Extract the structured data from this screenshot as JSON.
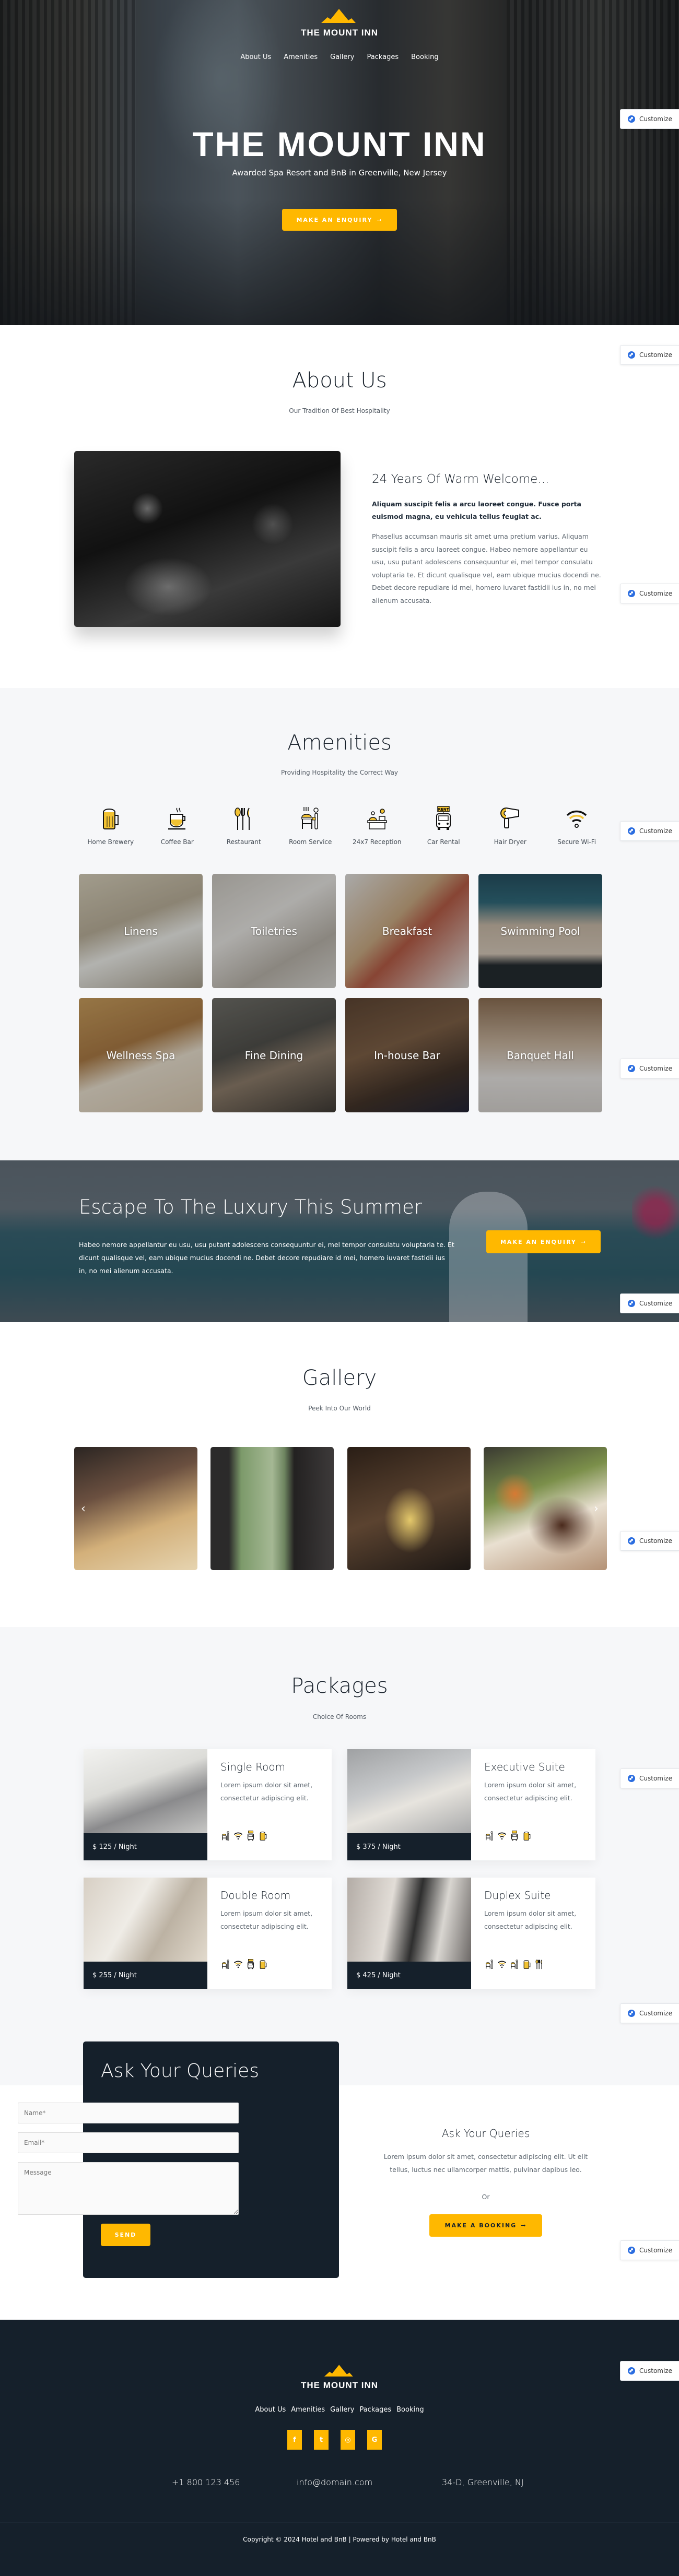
{
  "brand": {
    "name": "THE MOUNT INN",
    "accent": "#ffb800",
    "dark": "#15202b"
  },
  "nav": [
    "About Us",
    "Amenities",
    "Gallery",
    "Packages",
    "Booking"
  ],
  "hero": {
    "title": "THE MOUNT INN",
    "subtitle": "Awarded Spa Resort and BnB in Greenville, New Jersey",
    "cta": "MAKE AN ENQUIRY",
    "cta_icon": "arrow-right-icon"
  },
  "customize_label": "Customize",
  "about": {
    "title": "About Us",
    "subtitle": "Our Tradition Of Best Hospitality",
    "heading": "24 Years Of Warm Welcome...",
    "lead": "Aliquam suscipit felis a arcu laoreet congue. Fusce porta euismod magna, eu vehicula tellus feugiat ac.",
    "body": "Phasellus accumsan mauris sit amet urna pretium varius. Aliquam suscipit felis a arcu laoreet congue. Habeo nemore appellantur eu usu, usu putant adolescens consequuntur ei, mel tempor consulatu voluptaria te. Et dicunt qualisque vel, eam ubique mucius docendi ne. Debet decore repudiare id mei, homero iuvaret fastidii ius in, no mei alienum accusata."
  },
  "amenities": {
    "title": "Amenities",
    "subtitle": "Providing Hospitality the Correct Way",
    "icons": [
      {
        "label": "Home Brewery",
        "icon": "beer-mug-icon"
      },
      {
        "label": "Coffee Bar",
        "icon": "coffee-cup-icon"
      },
      {
        "label": "Restaurant",
        "icon": "cutlery-icon"
      },
      {
        "label": "Room Service",
        "icon": "room-service-icon"
      },
      {
        "label": "24x7 Reception",
        "icon": "reception-desk-icon"
      },
      {
        "label": "Car Rental",
        "icon": "car-rental-icon"
      },
      {
        "label": "Hair Dryer",
        "icon": "hair-dryer-icon"
      },
      {
        "label": "Secure Wi-Fi",
        "icon": "wifi-icon"
      }
    ],
    "tiles": [
      "Linens",
      "Toiletries",
      "Breakfast",
      "Swimming Pool",
      "Wellness Spa",
      "Fine Dining",
      "In-house Bar",
      "Banquet Hall"
    ]
  },
  "escape": {
    "title": "Escape To The Luxury This Summer",
    "body": "Habeo nemore appellantur eu usu, usu putant adolescens consequuntur ei, mel tempor consulatu voluptaria te. Et dicunt qualisque vel, eam ubique mucius docendi ne. Debet decore repudiare id mei, homero iuvaret fastidii ius in, no mei alienum accusata.",
    "cta": "MAKE AN ENQUIRY"
  },
  "gallery": {
    "title": "Gallery",
    "subtitle": "Peek Into Our World",
    "images": [
      "chef plating dish",
      "window with potted plant",
      "champagne glasses",
      "steak with asparagus"
    ],
    "prev": "‹",
    "next": "›"
  },
  "packages": {
    "title": "Packages",
    "subtitle": "Choice Of Rooms",
    "items": [
      {
        "name": "Single Room",
        "desc": "Lorem ipsum dolor sit amet, consectetur adipiscing elit.",
        "price": "$ 125 / Night",
        "icons": [
          "room-service-icon",
          "wifi-icon",
          "car-rental-icon",
          "beer-mug-icon"
        ]
      },
      {
        "name": "Executive Suite",
        "desc": "Lorem ipsum dolor sit amet, consectetur adipiscing elit.",
        "price": "$ 375 / Night",
        "icons": [
          "room-service-icon",
          "wifi-icon",
          "car-rental-icon",
          "beer-mug-icon"
        ]
      },
      {
        "name": "Double Room",
        "desc": "Lorem ipsum dolor sit amet, consectetur adipiscing elit.",
        "price": "$ 255 / Night",
        "icons": [
          "room-service-icon",
          "wifi-icon",
          "car-rental-icon",
          "beer-mug-icon"
        ]
      },
      {
        "name": "Duplex Suite",
        "desc": "Lorem ipsum dolor sit amet, consectetur adipiscing elit.",
        "price": "$ 425 / Night",
        "icons": [
          "room-service-icon",
          "wifi-icon",
          "room-service-icon",
          "beer-mug-icon",
          "cutlery-icon"
        ]
      }
    ]
  },
  "booking": {
    "form_title": "Ask Your Queries",
    "name_placeholder": "Name*",
    "email_placeholder": "Email*",
    "message_placeholder": "Message",
    "send": "SEND",
    "right_title": "Ask Your Queries",
    "right_body": "Lorem ipsum dolor sit amet, consectetur adipiscing elit. Ut elit tellus, luctus nec ullamcorper mattis, pulvinar dapibus leo.",
    "or": "Or",
    "cta": "MAKE A BOOKING"
  },
  "footer": {
    "brand": "THE MOUNT INN",
    "nav": [
      "About Us",
      "Amenities",
      "Gallery",
      "Packages",
      "Booking"
    ],
    "social": [
      {
        "name": "facebook",
        "glyph": "f"
      },
      {
        "name": "twitter",
        "glyph": "t"
      },
      {
        "name": "instagram",
        "glyph": "◎"
      },
      {
        "name": "google",
        "glyph": "G"
      }
    ],
    "phone": "+1 800 123 456",
    "email": "info@domain.com",
    "address": "34-D, Greenville, NJ",
    "copyright": "Copyright © 2024 Hotel and BnB | Powered by Hotel and BnB"
  }
}
